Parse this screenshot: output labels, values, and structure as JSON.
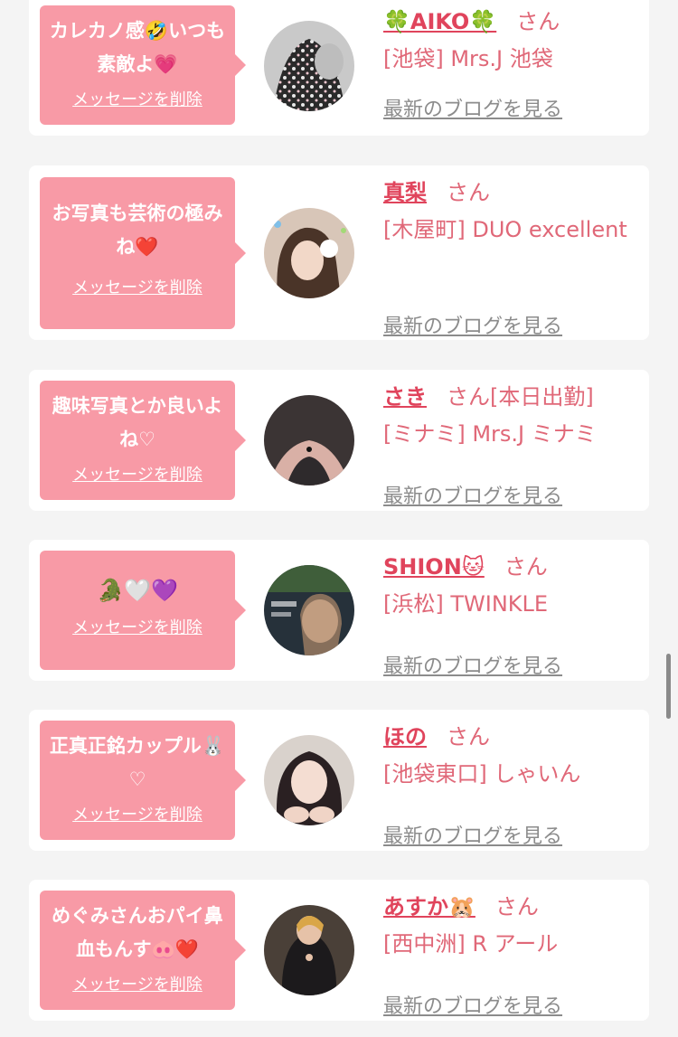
{
  "delete_label": "メッセージを削除",
  "blog_label": "最新のブログを見る",
  "san_label": "さん",
  "entries": [
    {
      "message": "カレカノ感🤣いつも素敵よ💗",
      "name": "🍀AIKO🍀",
      "status": "",
      "shop": "[池袋] Mrs.J 池袋"
    },
    {
      "message": "お写真も芸術の極みね❤️",
      "name": "真梨",
      "status": "",
      "shop": "[木屋町] DUO excellent"
    },
    {
      "message": "趣味写真とか良いよね♡",
      "name": "さき",
      "status": "[本日出勤]",
      "shop": "[ミナミ] Mrs.J ミナミ"
    },
    {
      "message": "🐊🤍💜",
      "name": "SHION🐱",
      "status": "",
      "shop": "[浜松] TWINKLE"
    },
    {
      "message": "正真正銘カップル🐰♡",
      "name": "ほの",
      "status": "",
      "shop": "[池袋東口] しゃいん"
    },
    {
      "message": "めぐみさんおパイ鼻血もんす🐽❤️",
      "name": "あすか🐹",
      "status": "",
      "shop": "[西中洲] R アール"
    }
  ],
  "colors": {
    "bubble": "#f89aa6",
    "name": "#e0445c",
    "text": "#e06878",
    "link_gray": "#8c8c8c",
    "card": "#ffffff",
    "background": "#f4f4f4"
  }
}
